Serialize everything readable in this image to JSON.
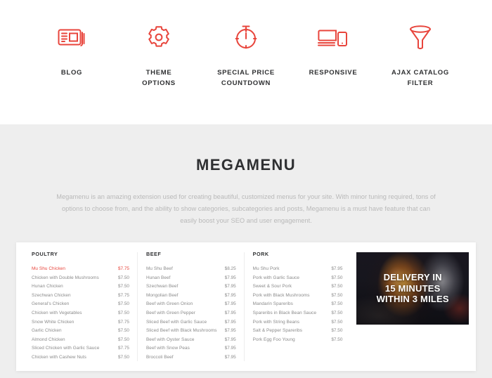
{
  "features": {
    "items": [
      {
        "icon": "newspaper-icon",
        "label": "BLOG"
      },
      {
        "icon": "gear-icon",
        "label": "THEME\nOPTIONS"
      },
      {
        "icon": "stopwatch-icon",
        "label": "SPECIAL PRICE\nCOUNTDOWN"
      },
      {
        "icon": "devices-icon",
        "label": "RESPONSIVE"
      },
      {
        "icon": "funnel-icon",
        "label": "AJAX CATALOG\nFILTER"
      }
    ]
  },
  "mega": {
    "title": "MEGAMENU",
    "description": "Megamenu is an amazing extension used for creating beautiful, customized menus for your site. With minor tuning required, tons of options to choose from, and the ability to show categories, subcategories and posts, Megamenu is a must have feature that can easily boost your SEO and user engagement."
  },
  "menu": {
    "columns": [
      {
        "title": "POULTRY",
        "items": [
          {
            "name": "Mu Shu Chicken",
            "price": "$7.75",
            "featured": true
          },
          {
            "name": "Chicken with Double Mushrooms",
            "price": "$7.50",
            "featured": false
          },
          {
            "name": "Hunan Chicken",
            "price": "$7.50",
            "featured": false
          },
          {
            "name": "Szechwan Chicken",
            "price": "$7.75",
            "featured": false
          },
          {
            "name": "General's Chicken",
            "price": "$7.50",
            "featured": false
          },
          {
            "name": "Chicken with Vegetables",
            "price": "$7.50",
            "featured": false
          },
          {
            "name": "Snow White Chicken",
            "price": "$7.75",
            "featured": false
          },
          {
            "name": "Garlic Chicken",
            "price": "$7.50",
            "featured": false
          },
          {
            "name": "Almond Chicken",
            "price": "$7.50",
            "featured": false
          },
          {
            "name": "Sliced Chicken with Garlic Sauce",
            "price": "$7.75",
            "featured": false
          },
          {
            "name": "Chicken with Cashew Nuts",
            "price": "$7.50",
            "featured": false
          }
        ]
      },
      {
        "title": "BEEF",
        "items": [
          {
            "name": "Mu Shu Beef",
            "price": "$8.25",
            "featured": false
          },
          {
            "name": "Hunan Beef",
            "price": "$7.95",
            "featured": false
          },
          {
            "name": "Szechwan Beef",
            "price": "$7.95",
            "featured": false
          },
          {
            "name": "Mongolian Beef",
            "price": "$7.95",
            "featured": false
          },
          {
            "name": "Beef with Green Onion",
            "price": "$7.95",
            "featured": false
          },
          {
            "name": "Beef with Green Pepper",
            "price": "$7.95",
            "featured": false
          },
          {
            "name": "Sliced Beef with Garlic Sauce",
            "price": "$7.95",
            "featured": false
          },
          {
            "name": "Sliced Beef with Black Mushrooms",
            "price": "$7.95",
            "featured": false
          },
          {
            "name": "Beef with Oyster Sauce",
            "price": "$7.95",
            "featured": false
          },
          {
            "name": "Beef with Snow Peas",
            "price": "$7.95",
            "featured": false
          },
          {
            "name": "Broccoli Beef",
            "price": "$7.95",
            "featured": false
          }
        ]
      },
      {
        "title": "PORK",
        "items": [
          {
            "name": "Mu Shu Pork",
            "price": "$7.95",
            "featured": false
          },
          {
            "name": "Pork with Garlic Sauce",
            "price": "$7.50",
            "featured": false
          },
          {
            "name": "Sweet & Sour Pork",
            "price": "$7.50",
            "featured": false
          },
          {
            "name": "Pork with Black Mushrooms",
            "price": "$7.50",
            "featured": false
          },
          {
            "name": "Mandarin Spareribs",
            "price": "$7.50",
            "featured": false
          },
          {
            "name": "Spareribs in Black Bean Sauce",
            "price": "$7.50",
            "featured": false
          },
          {
            "name": "Pork with String Beans",
            "price": "$7.50",
            "featured": false
          },
          {
            "name": "Salt & Pepper Spareribs",
            "price": "$7.50",
            "featured": false
          },
          {
            "name": "Pork Egg Foo Young",
            "price": "$7.50",
            "featured": false
          }
        ]
      }
    ]
  },
  "promo": {
    "line1": "DELIVERY IN",
    "line2": "15 MINUTES",
    "line3": "WITHIN 3 MILES"
  },
  "colors": {
    "accent": "#e8453c",
    "heading": "#2f3032",
    "body_text": "#8a8a8a",
    "muted_text": "#b9b9b9",
    "section_bg": "#eeeeee",
    "panel_bg": "#ffffff"
  }
}
